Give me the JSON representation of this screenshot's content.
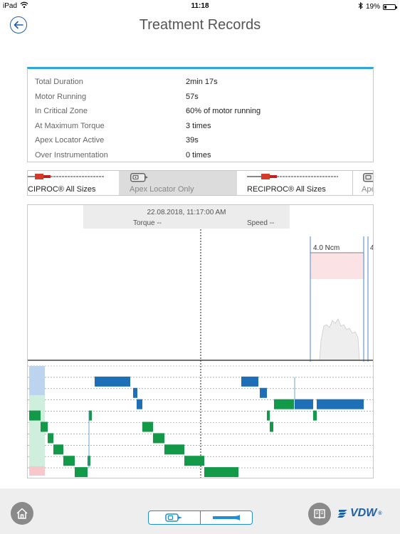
{
  "status_bar": {
    "device": "iPad",
    "time": "11:18",
    "battery": "19%",
    "battery_level": 0.19
  },
  "header": {
    "title": "Treatment Records"
  },
  "summary": [
    {
      "label": "Total Duration",
      "value": "2min 17s"
    },
    {
      "label": "Motor Running",
      "value": "57s"
    },
    {
      "label": "In Critical Zone",
      "value": "60% of motor running"
    },
    {
      "label": "At Maximum Torque",
      "value": "3 times"
    },
    {
      "label": "Apex Locator Active",
      "value": "39s"
    },
    {
      "label": "Over Instrumentation",
      "value": "0 times"
    }
  ],
  "file_strip": {
    "items": [
      {
        "label": "CIPROC® All Sizes",
        "icon": "file-instrument-icon",
        "selected": false
      },
      {
        "label": "Apex Locator Only",
        "icon": "apex-locator-icon",
        "selected": true
      },
      {
        "label": "RECIPROC® All Sizes",
        "icon": "file-instrument-icon",
        "selected": false
      },
      {
        "label": "Ape",
        "icon": "apex-locator-icon",
        "selected": false
      }
    ]
  },
  "chart": {
    "datetime": "22.08.2018, 11:17:00 AM",
    "torque_label": "Torque --",
    "speed_label": "Speed --",
    "torque_limit_label": "4.0 Ncm",
    "torque_limit_label_partial": "4",
    "colors": {
      "blue": "#1f6fb8",
      "green": "#139a48",
      "light_blue": "#bcd4ee",
      "light_green": "#cfeedd",
      "pink": "#f7c7cc",
      "limit_band": "#fbe3e5",
      "limit_line": "#6d9bd1",
      "torque_fill": "#eeeeee"
    }
  },
  "bottom_bar": {
    "brand": "VDW",
    "brand_mark": "®"
  }
}
